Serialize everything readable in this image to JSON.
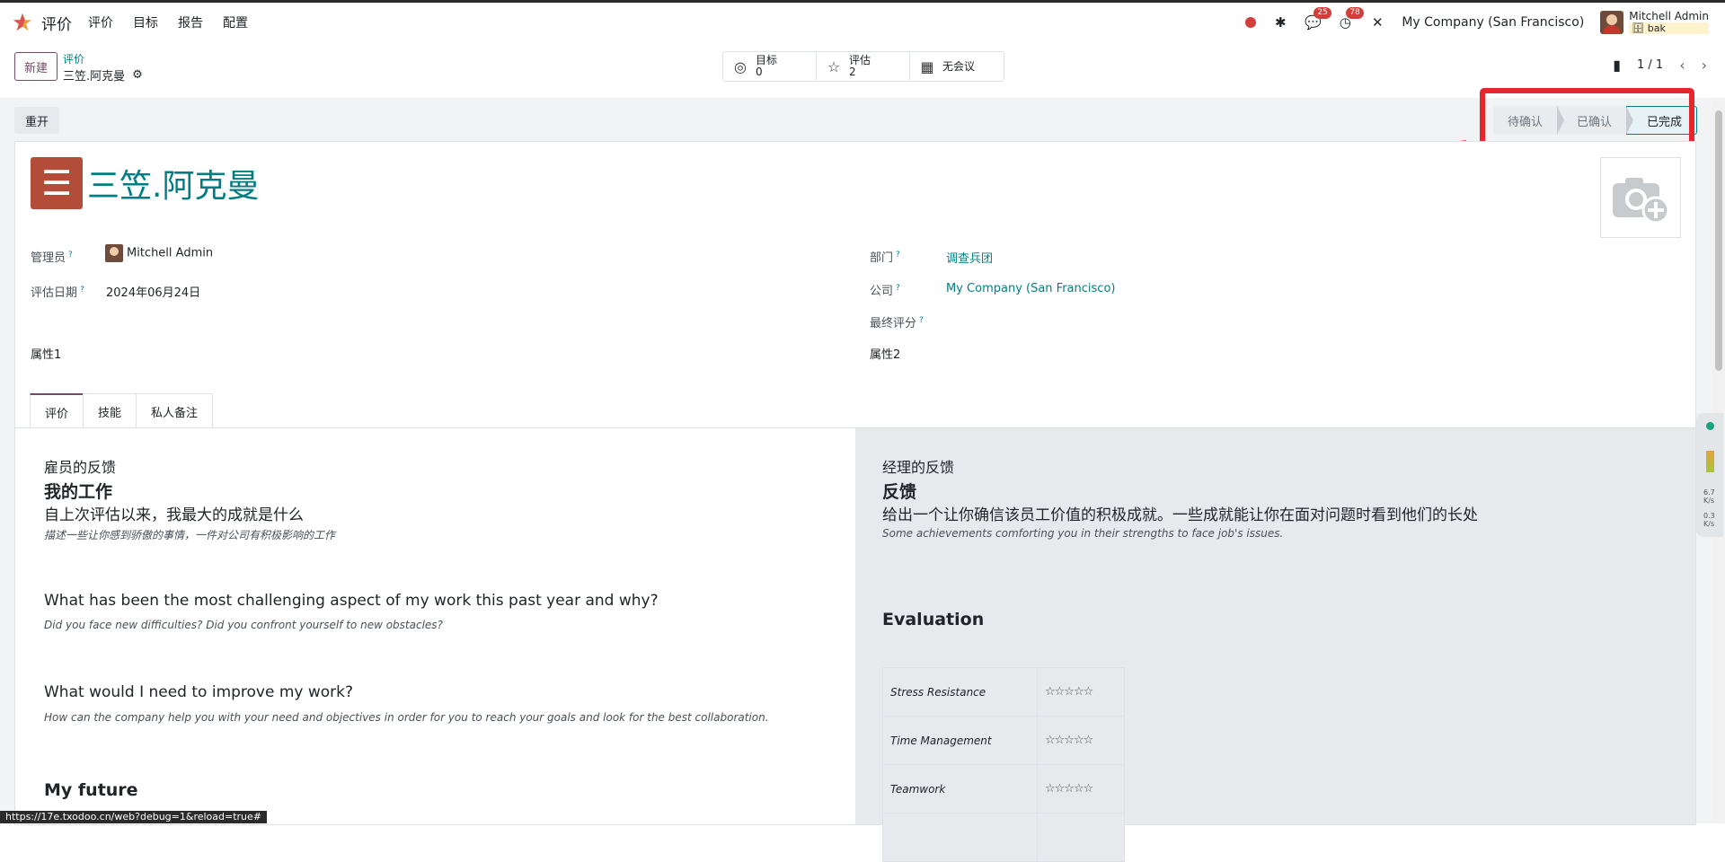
{
  "nav": {
    "app_name": "评价",
    "menu": [
      "评价",
      "目标",
      "报告",
      "配置"
    ],
    "badge_messages": "25",
    "badge_activities": "78",
    "company": "My Company (San Francisco)",
    "user_name": "Mitchell Admin",
    "db": "bak"
  },
  "control": {
    "new_label": "新建",
    "breadcrumb_parent": "评价",
    "breadcrumb_current": "三笠.阿克曼",
    "smart_goals_label": "目标",
    "smart_goals_value": "0",
    "smart_eval_label": "评估",
    "smart_eval_value": "2",
    "smart_meeting_label": "无会议",
    "pager": "1 / 1"
  },
  "status": {
    "reopen_label": "重开",
    "stages": [
      "待确认",
      "已确认",
      "已完成"
    ],
    "active_stage": "已完成"
  },
  "form": {
    "title": "三笠.阿克曼",
    "manager_label": "管理员",
    "manager_value": "Mitchell Admin",
    "date_label": "评估日期",
    "date_value": "2024年06月24日",
    "dept_label": "部门",
    "dept_value": "调查兵团",
    "company_label": "公司",
    "company_value": "My Company (San Francisco)",
    "final_label": "最终评分",
    "prop1": "属性1",
    "prop2": "属性2"
  },
  "tabs": [
    "评价",
    "技能",
    "私人备注"
  ],
  "employee": {
    "heading": "雇员的反馈",
    "section": "我的工作",
    "q1": "自上次评估以来，我最大的成就是什么",
    "q1_hint": "描述一些让你感到骄傲的事情，一件对公司有积极影响的工作",
    "q2": "What has been the most challenging aspect of my work this past year and why?",
    "q2_hint": "Did you face new difficulties? Did you confront yourself to new obstacles?",
    "q3": "What would I need to improve my work?",
    "q3_hint": "How can the company help you with your need and objectives in order for you to reach your goals and look for the best collaboration.",
    "section2": "My future"
  },
  "manager": {
    "heading": "经理的反馈",
    "section": "反馈",
    "q1": "给出一个让你确信该员工价值的积极成就。一些成就能让你在面对问题时看到他们的长处",
    "q1_hint": "Some achievements comforting you in their strengths to face job's issues.",
    "evaluation": "Evaluation",
    "criteria": [
      "Stress Resistance",
      "Time Management",
      "Teamwork"
    ],
    "stars": "☆☆☆☆☆"
  },
  "side_widget": {
    "up": "6.7",
    "down": "0.3",
    "unit": "K/s"
  },
  "status_url": "https://17e.txodoo.cn/web?debug=1&reload=true#"
}
